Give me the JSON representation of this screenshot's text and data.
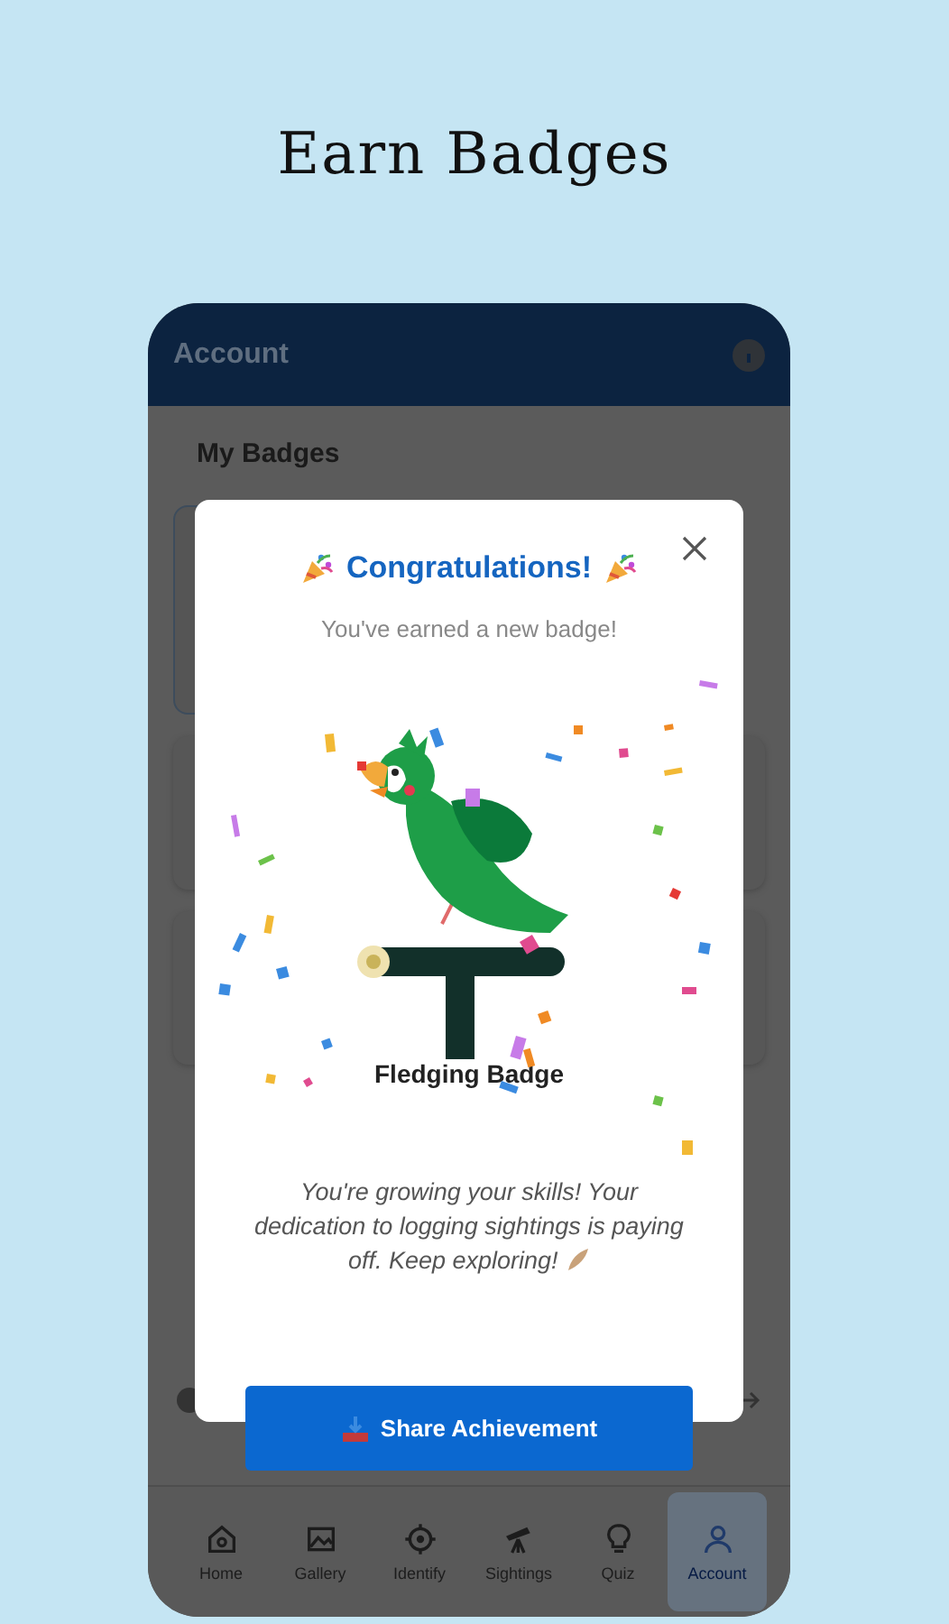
{
  "screen_title": "Earn Badges",
  "app_bar": {
    "title": "Account"
  },
  "section_title": "My Badges",
  "dialog": {
    "title": "Congratulations!",
    "subtitle": "You've earned a new badge!",
    "badge_name": "Fledging Badge",
    "message": "You're growing your skills! Your dedication to logging sightings is paying off. Keep exploring!",
    "share_button": "Share Achievement"
  },
  "nav": [
    {
      "label": "Home",
      "selected": false
    },
    {
      "label": "Gallery",
      "selected": false
    },
    {
      "label": "Identify",
      "selected": false
    },
    {
      "label": "Sightings",
      "selected": false
    },
    {
      "label": "Quiz",
      "selected": false
    },
    {
      "label": "Account",
      "selected": true
    }
  ]
}
